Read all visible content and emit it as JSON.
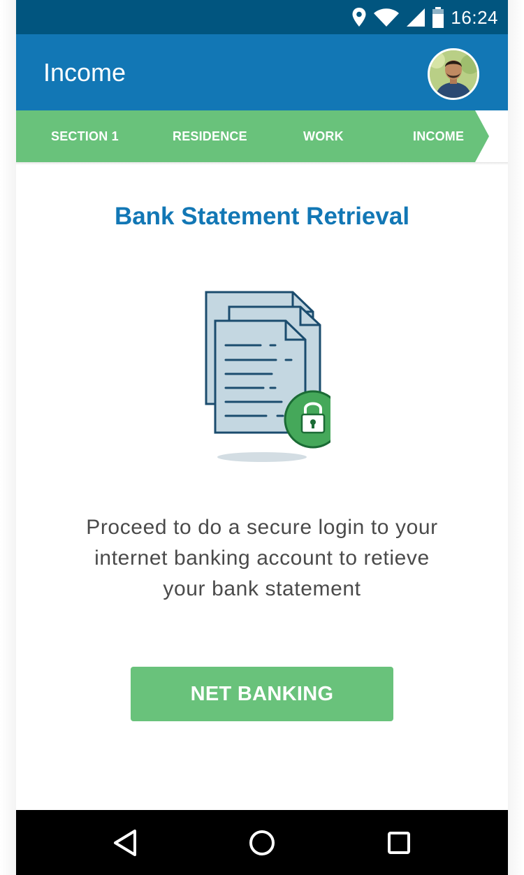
{
  "status_bar": {
    "time": "16:24",
    "icons": [
      "location-icon",
      "wifi-icon",
      "cellular-signal-icon",
      "battery-icon"
    ]
  },
  "app_bar": {
    "title": "Income",
    "avatar": "user-avatar"
  },
  "steps": {
    "items": [
      {
        "label": "SECTION 1"
      },
      {
        "label": "RESIDENCE"
      },
      {
        "label": "WORK"
      },
      {
        "label": "INCOME"
      }
    ],
    "current": "INCOME"
  },
  "main": {
    "heading": "Bank Statement Retrieval",
    "illustration": "documents-with-lock-icon",
    "message_lines": [
      "Proceed to do a secure login to your",
      "internet banking account to retieve",
      "your bank statement"
    ],
    "button_label": "NET BANKING"
  },
  "nav_bar": {
    "icons": [
      "back-icon",
      "home-icon",
      "recents-icon"
    ]
  },
  "colors": {
    "status_bar": "#01557f",
    "app_bar": "#1277b5",
    "accent_green": "#69c27b",
    "heading_blue": "#1277b5",
    "text_gray": "#4a4a4a"
  }
}
